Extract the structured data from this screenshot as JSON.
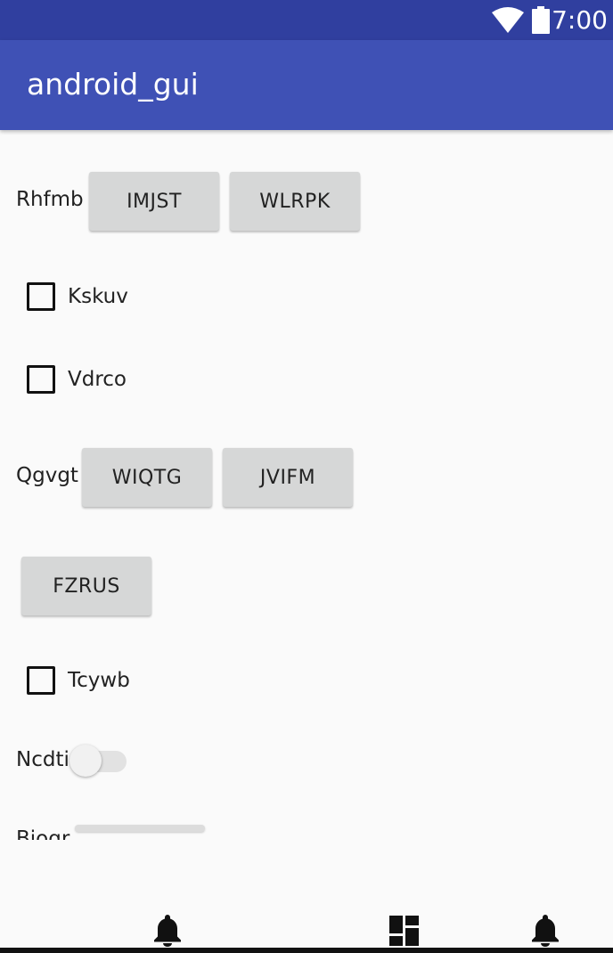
{
  "status_bar": {
    "time": "7:00",
    "icons": [
      "wifi-icon",
      "battery-icon"
    ]
  },
  "app_bar": {
    "title": "android_gui"
  },
  "rows": {
    "row1": {
      "label": "Rhfmb",
      "button1": "IMJST",
      "button2": "WLRPK"
    },
    "checkbox1": {
      "label": "Kskuv",
      "checked": false
    },
    "checkbox2": {
      "label": "Vdrco",
      "checked": false
    },
    "row2": {
      "label": "Qgvgt",
      "button1": "WIQTG",
      "button2": "JVIFM"
    },
    "button3": "FZRUS",
    "checkbox3": {
      "label": "Tcywb",
      "checked": false
    },
    "switch": {
      "label": "Ncdti",
      "on": false
    },
    "seek": {
      "label": "Biogr"
    }
  },
  "bottom_nav": {
    "icons": [
      "notification-icon",
      "dashboard-icon",
      "notification-icon"
    ]
  }
}
